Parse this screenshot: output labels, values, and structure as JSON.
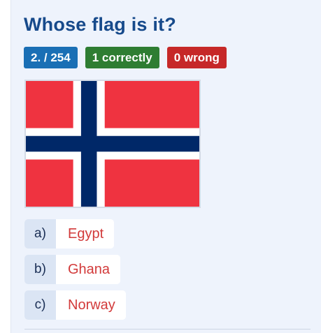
{
  "quiz": {
    "title": "Whose flag is it?",
    "badges": {
      "progress": "2. / 254",
      "correct": "1 correctly",
      "wrong": "0  wrong"
    },
    "flag": {
      "icon": "norway-flag",
      "colors": {
        "red": "#ef3340",
        "white": "#ffffff",
        "blue": "#002868"
      }
    },
    "answers": [
      {
        "key": "a)",
        "label": "Egypt"
      },
      {
        "key": "b)",
        "label": "Ghana"
      },
      {
        "key": "c)",
        "label": "Norway"
      }
    ]
  }
}
